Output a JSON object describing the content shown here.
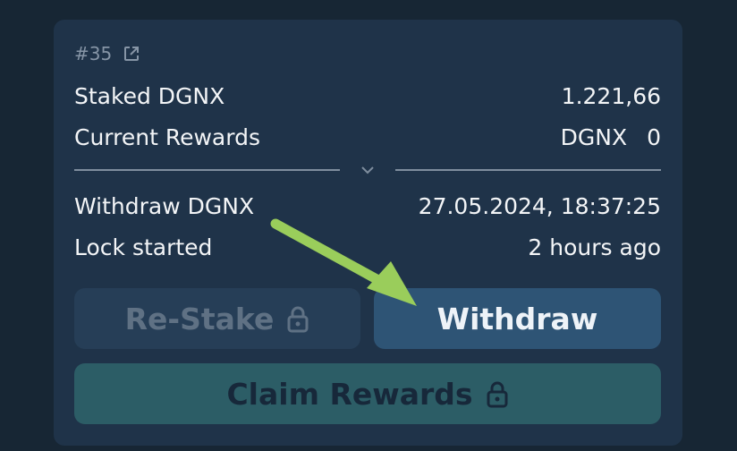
{
  "card": {
    "id_label": "#35",
    "external_link_icon": "external-link-icon"
  },
  "details": {
    "staked_label": "Staked DGNX",
    "staked_value": "1.221,66",
    "rewards_label": "Current Rewards",
    "rewards_token": "DGNX",
    "rewards_value": "0",
    "withdraw_label": "Withdraw DGNX",
    "withdraw_value": "27.05.2024, 18:37:25",
    "lock_label": "Lock started",
    "lock_value": "2 hours ago"
  },
  "buttons": {
    "restake_label": "Re-Stake",
    "withdraw_label": "Withdraw",
    "claim_label": "Claim Rewards"
  },
  "colors": {
    "background": "#172634",
    "card": "#1f3349",
    "withdraw_button": "#2e5475",
    "claim_button": "#2c5d66",
    "annotation_arrow": "#9acd5b"
  },
  "icons": [
    "external-link-icon",
    "chevron-down-icon",
    "lock-icon",
    "arrow-annotation"
  ]
}
